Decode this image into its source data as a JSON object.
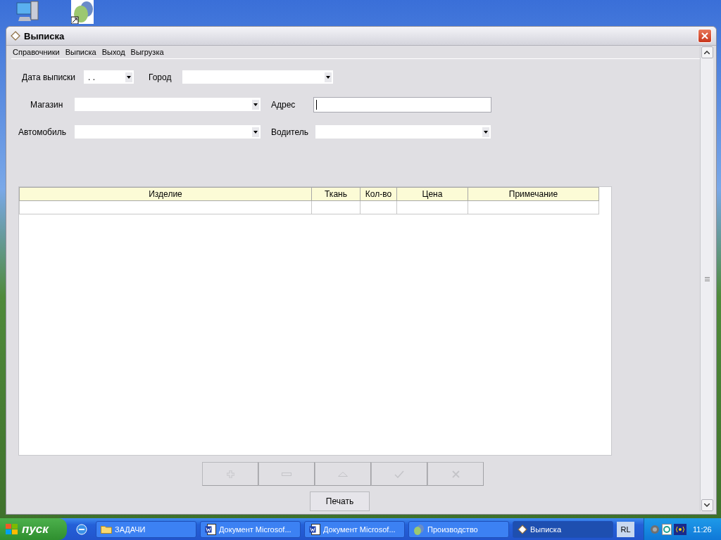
{
  "window": {
    "title": "Выписка",
    "menu": [
      "Справочники",
      "Выписка",
      "Выход",
      "Выгрузка"
    ],
    "form": {
      "date": {
        "label": "Дата выписки",
        "value": ". ."
      },
      "city": {
        "label": "Город"
      },
      "store": {
        "label": "Магазин"
      },
      "address": {
        "label": "Адрес"
      },
      "car": {
        "label": "Автомобиль"
      },
      "driver": {
        "label": "Водитель"
      }
    },
    "table": {
      "columns": [
        "Изделие",
        "Ткань",
        "Кол-во",
        "Цена",
        "Примечание"
      ]
    },
    "toolbar": [
      {
        "kind": "add",
        "disabled": true
      },
      {
        "kind": "remove",
        "disabled": true
      },
      {
        "kind": "up",
        "disabled": true
      },
      {
        "kind": "confirm",
        "disabled": true
      },
      {
        "kind": "cancel",
        "disabled": true
      }
    ],
    "print_button": "Печать"
  },
  "taskbar": {
    "start": "пуск",
    "tasks": [
      {
        "label": "ЗАДАЧИ",
        "kind": "folder",
        "selected": false
      },
      {
        "label": "Документ Microsof...",
        "kind": "word",
        "selected": false
      },
      {
        "label": "Документ Microsof...",
        "kind": "word",
        "selected": false
      },
      {
        "label": "Производство",
        "kind": "app",
        "selected": false
      },
      {
        "label": "Выписка",
        "kind": "form",
        "selected": true
      }
    ],
    "language": "RL",
    "clock": "11:26"
  }
}
